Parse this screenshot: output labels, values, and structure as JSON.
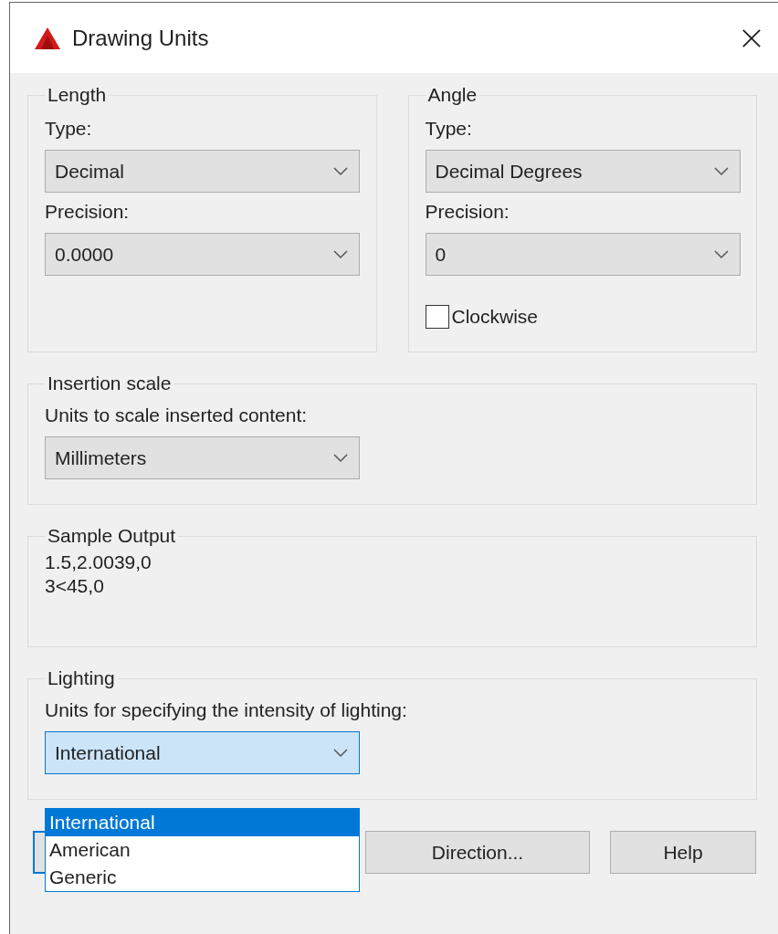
{
  "window": {
    "title": "Drawing Units"
  },
  "length": {
    "label": "Length",
    "type_label": "Type:",
    "type": "Decimal",
    "precision_label": "Precision:",
    "precision": "0.0000"
  },
  "angle": {
    "label": "Angle",
    "type_label": "Type:",
    "type": "Decimal Degrees",
    "precision_label": "Precision:",
    "precision": "0",
    "clockwise": {
      "label": "Clockwise",
      "checked": false
    }
  },
  "insertion_scale": {
    "label": "Insertion scale",
    "units_label": "Units to scale inserted content:",
    "units": "Millimeters"
  },
  "sample_output": {
    "label": "Sample Output",
    "lines": [
      "1.5,2.0039,0",
      "3<45,0"
    ]
  },
  "lighting": {
    "label": "Lighting",
    "units_label": "Units for specifying the intensity of lighting:",
    "units": "International",
    "expanded": true,
    "options": [
      {
        "label": "International",
        "selected": true
      },
      {
        "label": "American",
        "selected": false
      },
      {
        "label": "Generic",
        "selected": false
      }
    ]
  },
  "buttons": [
    {
      "kind": "default"
    },
    {
      "kind": "plain",
      "label": "Direction..."
    },
    {
      "kind": "plain",
      "label": "Help"
    }
  ]
}
